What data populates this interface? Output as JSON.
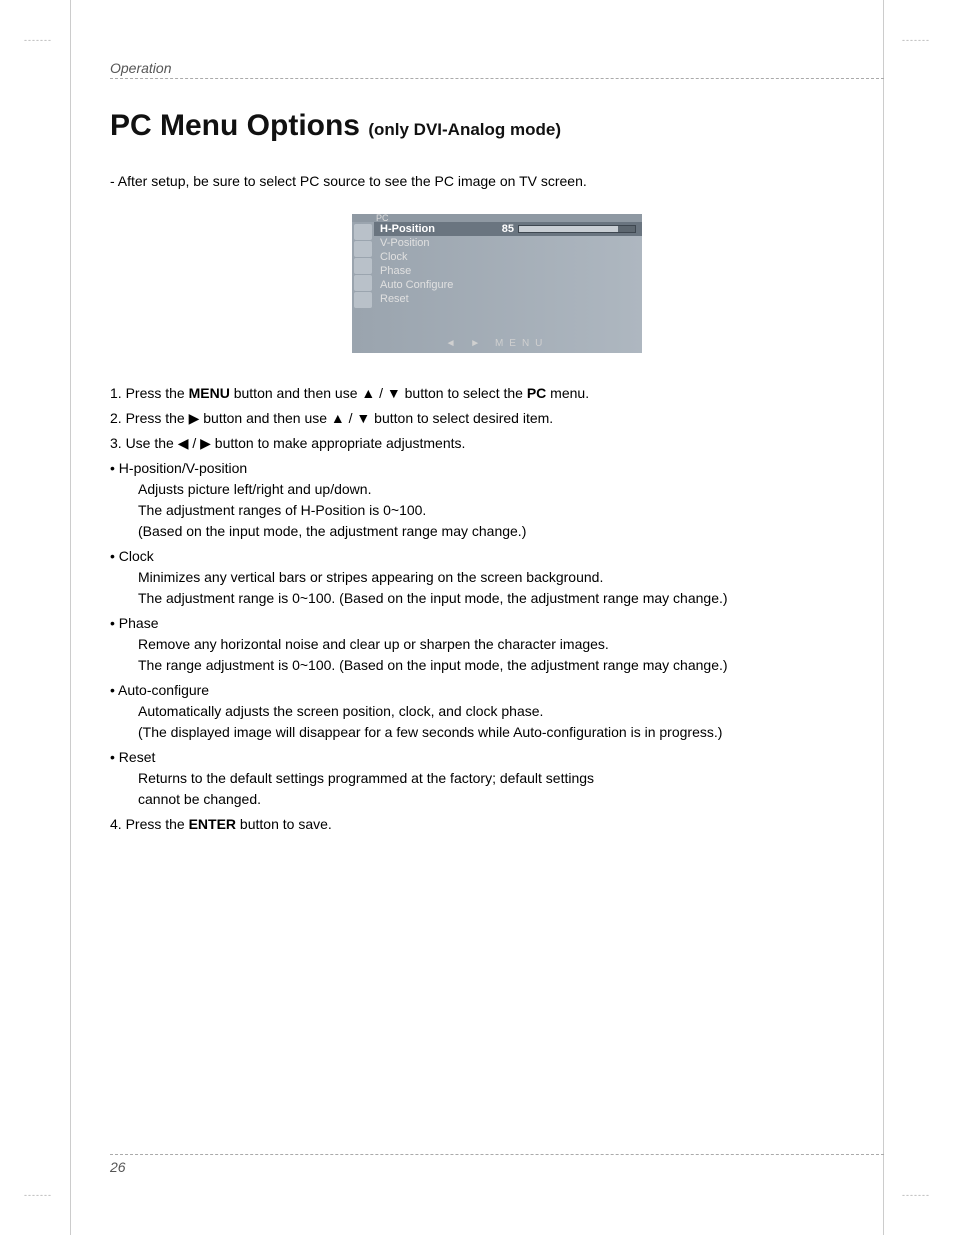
{
  "header": {
    "section": "Operation"
  },
  "title": {
    "main": "PC Menu Options",
    "sub": "(only DVI-Analog mode)"
  },
  "intro": "- After setup, be sure to select PC source to see the PC image on TV screen.",
  "osd": {
    "tab": "PC",
    "items": [
      {
        "label": "H-Position",
        "value": "85",
        "selected": true,
        "has_slider": true
      },
      {
        "label": "V-Position"
      },
      {
        "label": "Clock"
      },
      {
        "label": "Phase"
      },
      {
        "label": "Auto Configure"
      },
      {
        "label": "Reset"
      }
    ],
    "footer": "◄ ► MENU"
  },
  "steps": {
    "s1a": "1. Press the ",
    "s1b": "MENU",
    "s1c": " button and then use ▲ / ▼ button to select the ",
    "s1d": "PC",
    "s1e": " menu.",
    "s2": "2. Press the ▶ button and then use ▲ / ▼ button to select desired item.",
    "s3": "3. Use the ◀ / ▶ button to make appropriate adjustments.",
    "b1_t": "H-position/V-position",
    "b1_d1": "Adjusts picture left/right and up/down.",
    "b1_d2": "The adjustment ranges of H-Position is 0~100.",
    "b1_d3": "(Based on the input mode, the adjustment range may change.)",
    "b2_t": "Clock",
    "b2_d1": "Minimizes any vertical bars or stripes appearing on the screen background.",
    "b2_d2": "The adjustment range is 0~100. (Based on the input mode, the adjustment range may change.)",
    "b3_t": "Phase",
    "b3_d1": "Remove any horizontal noise and clear up or sharpen the character images.",
    "b3_d2": "The range adjustment is 0~100. (Based on the input mode, the adjustment range may change.)",
    "b4_t": "Auto-configure",
    "b4_d1": "Automatically adjusts the screen position, clock, and clock phase.",
    "b4_d2": "(The displayed image will disappear for a few seconds while Auto-configuration is in progress.)",
    "b5_t": "Reset",
    "b5_d1": "Returns to the default settings programmed at the factory; default settings",
    "b5_d2": "cannot be changed.",
    "s4a": "4. Press the ",
    "s4b": "ENTER",
    "s4c": " button to save."
  },
  "footer": {
    "page": "26"
  }
}
